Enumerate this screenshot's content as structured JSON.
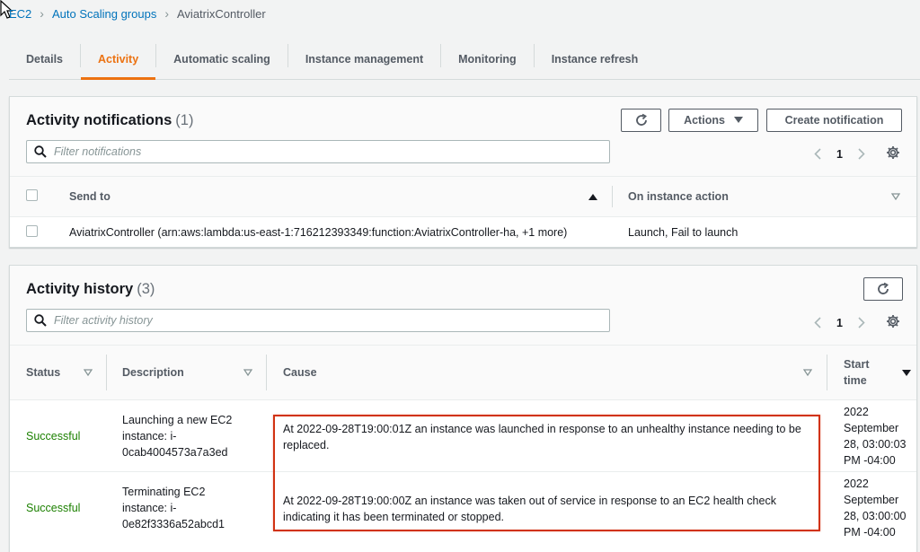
{
  "breadcrumb": {
    "items": [
      "EC2",
      "Auto Scaling groups"
    ],
    "current": "AviatrixController"
  },
  "tabs": [
    "Details",
    "Activity",
    "Automatic scaling",
    "Instance management",
    "Monitoring",
    "Instance refresh"
  ],
  "active_tab": "Activity",
  "notifications": {
    "title": "Activity notifications",
    "count": "(1)",
    "actions_label": "Actions",
    "create_label": "Create notification",
    "filter_placeholder": "Filter notifications",
    "page": "1",
    "columns": {
      "send_to": "Send to",
      "on_instance_action": "On instance action"
    },
    "rows": [
      {
        "send_to": "AviatrixController (arn:aws:lambda:us-east-1:716212393349:function:AviatrixController-ha, +1 more)",
        "action": "Launch, Fail to launch"
      }
    ]
  },
  "history": {
    "title": "Activity history",
    "count": "(3)",
    "filter_placeholder": "Filter activity history",
    "page": "1",
    "columns": {
      "status": "Status",
      "description": "Description",
      "cause": "Cause",
      "start_time_1": "Start",
      "start_time_2": "time"
    },
    "rows": [
      {
        "status": "Successful",
        "description": [
          "Launching a new EC2",
          "instance: i-",
          "0cab4004573a7a3ed"
        ],
        "cause": "At 2022-09-28T19:00:01Z an instance was launched in response to an unhealthy instance needing to be replaced.",
        "start": [
          "2022",
          "September",
          "28, 03:00:03",
          "PM -04:00"
        ]
      },
      {
        "status": "Successful",
        "description": [
          "Terminating EC2",
          "instance: i-",
          "0e82f3336a52abcd1"
        ],
        "cause": "At 2022-09-28T19:00:00Z an instance was taken out of service in response to an EC2 health check indicating it has been terminated or stopped.",
        "start": [
          "2022",
          "September",
          "28, 03:00:00",
          "PM -04:00"
        ]
      }
    ]
  },
  "colors": {
    "link": "#0073bb",
    "accent": "#ec7211",
    "success": "#1d8102",
    "highlight": "#d13212"
  }
}
